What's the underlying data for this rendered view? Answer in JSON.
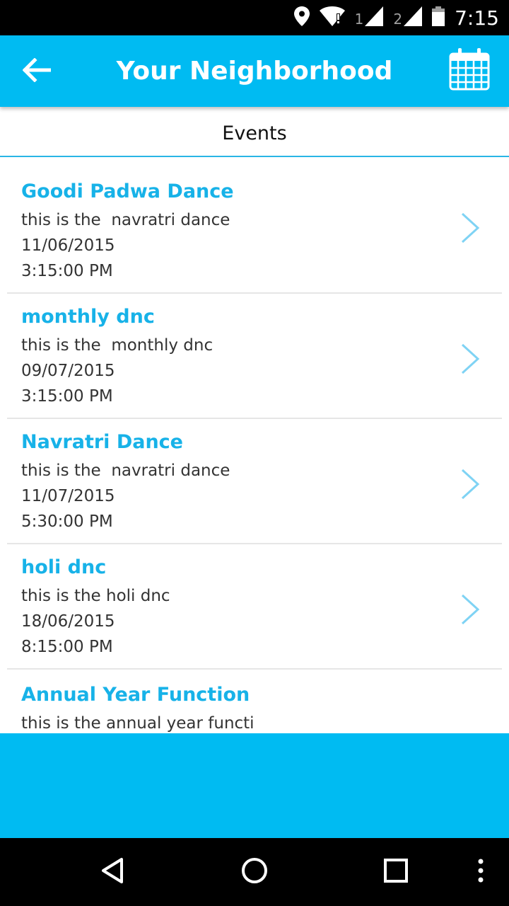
{
  "status_bar": {
    "time": "7:15",
    "sim1_label": "1",
    "sim2_label": "2",
    "icons": [
      "location-icon",
      "wifi-alert-icon",
      "signal-icon",
      "signal-icon",
      "battery-icon"
    ]
  },
  "app_bar": {
    "title": "Your Neighborhood",
    "back_icon": "arrow-left-icon",
    "calendar_icon": "calendar-icon",
    "color": "#00bbf2"
  },
  "section": {
    "title": "Events",
    "divider_color": "#29b6e6"
  },
  "events": [
    {
      "title": "Goodi Padwa Dance",
      "description": "this is the  navratri dance",
      "date": "11/06/2015",
      "time": "3:15:00 PM"
    },
    {
      "title": "monthly dnc",
      "description": "this is the  monthly dnc",
      "date": "09/07/2015",
      "time": "3:15:00 PM"
    },
    {
      "title": "Navratri Dance",
      "description": "this is the  navratri dance",
      "date": "11/07/2015",
      "time": "5:30:00 PM"
    },
    {
      "title": "holi dnc",
      "description": "this is the holi dnc",
      "date": "18/06/2015",
      "time": "8:15:00 PM"
    },
    {
      "title": "Annual Year Function",
      "description": "this is the annual year functi"
    }
  ],
  "colors": {
    "accent": "#00bbf2",
    "event_title": "#17b2e8",
    "chevron": "#7fd3f4"
  },
  "nav_bar": {
    "icons": [
      "back-triangle-icon",
      "home-circle-icon",
      "recents-square-icon",
      "overflow-menu-icon"
    ]
  }
}
